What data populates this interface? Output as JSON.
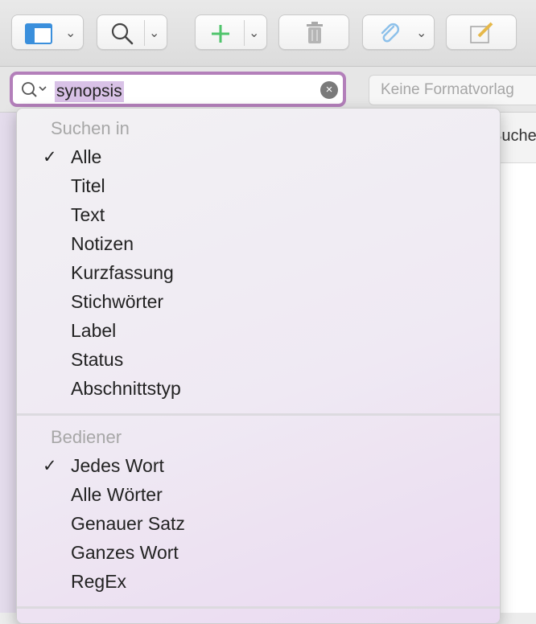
{
  "search": {
    "value": "synopsis",
    "clear_icon": "×"
  },
  "format": {
    "placeholder": "Keine Formatvorlag"
  },
  "background": {
    "panel_text": "Suche"
  },
  "menu": {
    "section1": {
      "header": "Suchen in",
      "items": [
        {
          "label": "Alle",
          "checked": true
        },
        {
          "label": "Titel",
          "checked": false
        },
        {
          "label": "Text",
          "checked": false
        },
        {
          "label": "Notizen",
          "checked": false
        },
        {
          "label": "Kurzfassung",
          "checked": false
        },
        {
          "label": "Stichwörter",
          "checked": false
        },
        {
          "label": "Label",
          "checked": false
        },
        {
          "label": "Status",
          "checked": false
        },
        {
          "label": "Abschnittstyp",
          "checked": false
        }
      ]
    },
    "section2": {
      "header": "Bediener",
      "items": [
        {
          "label": "Jedes Wort",
          "checked": true
        },
        {
          "label": "Alle Wörter",
          "checked": false
        },
        {
          "label": "Genauer Satz",
          "checked": false
        },
        {
          "label": "Ganzes Wort",
          "checked": false
        },
        {
          "label": "RegEx",
          "checked": false
        }
      ]
    },
    "check_mark": "✓"
  },
  "colors": {
    "accent": "#b37fba",
    "selection": "#d9c2e7",
    "add_green": "#4fc46b"
  }
}
